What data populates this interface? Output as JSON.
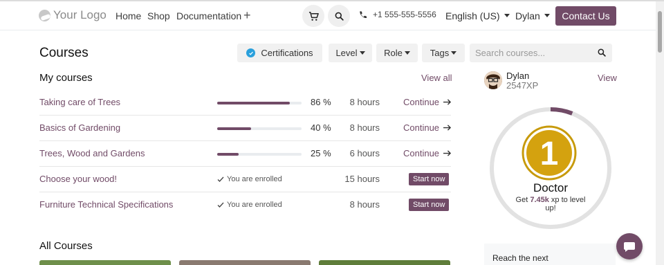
{
  "header": {
    "logo_text": "Your Logo",
    "nav": [
      "Home",
      "Shop",
      "Documentation"
    ],
    "plus": "+",
    "phone": "+1 555-555-5556",
    "language": "English (US)",
    "user": "Dylan",
    "contact_label": "Contact Us"
  },
  "courses": {
    "title": "Courses",
    "filters": {
      "certifications": "Certifications",
      "level": "Level",
      "role": "Role",
      "tags": "Tags"
    },
    "search_placeholder": "Search courses..."
  },
  "my_courses": {
    "title": "My courses",
    "view_all": "View all",
    "rows": [
      {
        "name": "Taking care of Trees",
        "progress": 86,
        "progress_label": "86 %",
        "hours": "8 hours",
        "action": "Continue"
      },
      {
        "name": "Basics of Gardening",
        "progress": 40,
        "progress_label": "40 %",
        "hours": "8 hours",
        "action": "Continue"
      },
      {
        "name": "Trees, Wood and Gardens",
        "progress": 25,
        "progress_label": "25 %",
        "hours": "6 hours",
        "action": "Continue"
      },
      {
        "name": "Choose your wood!",
        "enrolled": "You are enrolled",
        "hours": "15 hours",
        "action": "Start now"
      },
      {
        "name": "Furniture Technical Specifications",
        "enrolled": "You are enrolled",
        "hours": "8 hours",
        "action": "Start now"
      }
    ]
  },
  "all_courses": {
    "title": "All Courses"
  },
  "profile": {
    "name": "Dylan",
    "xp": "2547XP",
    "view": "View",
    "rank_number": "1",
    "rank_title": "Doctor",
    "progress_fraction": 0.06,
    "next_pre": "Get ",
    "next_xp": "7.45k",
    "next_post": " xp to level up!",
    "reach_text": "Reach the next"
  },
  "colors": {
    "accent": "#714b67",
    "badge_gold": "#d4a20f",
    "check_blue": "#2aa0dc"
  },
  "icons": [
    "cart-icon",
    "search-icon",
    "phone-icon",
    "check-icon",
    "arrow-right-icon",
    "chat-icon"
  ]
}
